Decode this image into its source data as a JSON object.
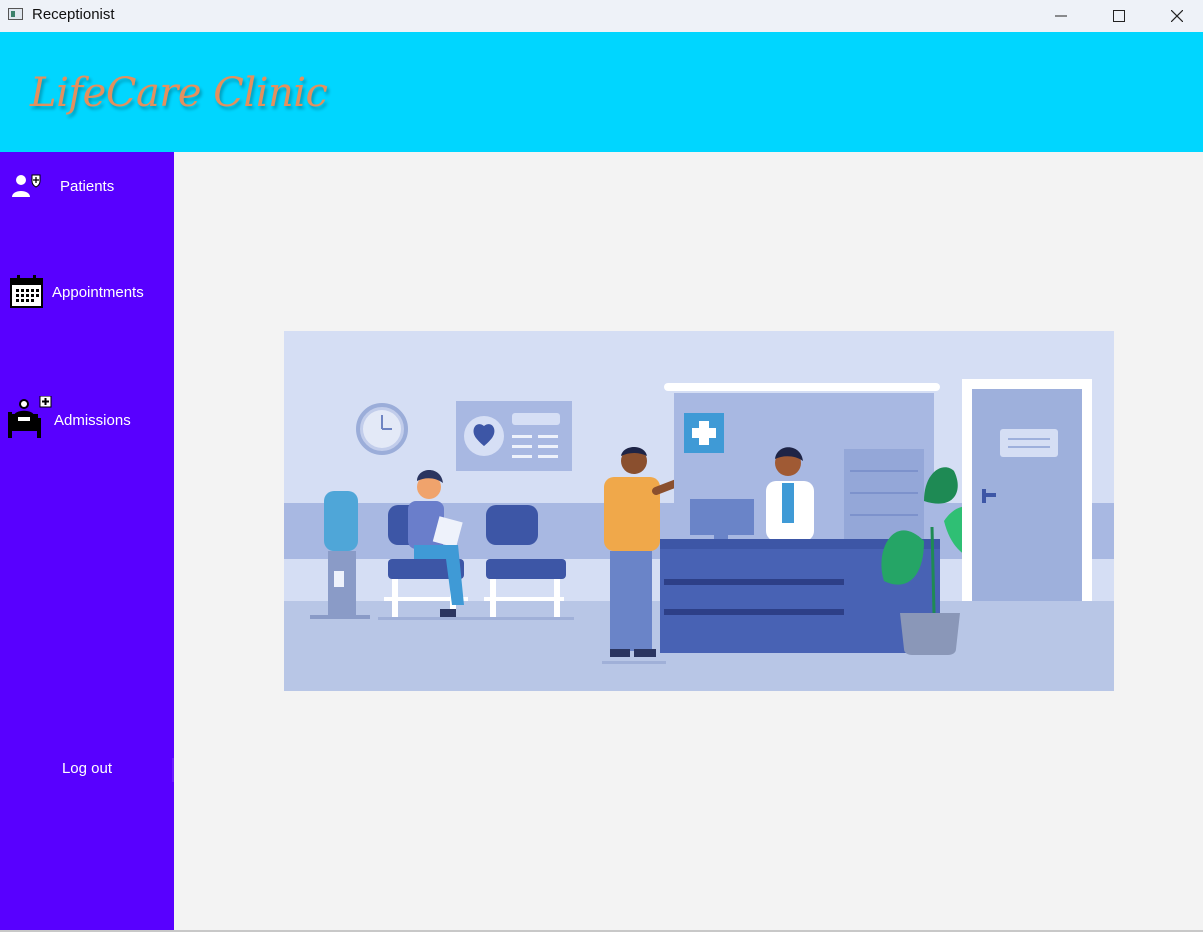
{
  "window": {
    "title": "Receptionist"
  },
  "header": {
    "brand": "LifeCare Clinic"
  },
  "sidebar": {
    "items": [
      {
        "label": "Patients",
        "icon": "patient-icon"
      },
      {
        "label": "Appointments",
        "icon": "calendar-icon"
      },
      {
        "label": "Admissions",
        "icon": "hospital-bed-icon"
      }
    ],
    "logout_label": "Log out"
  },
  "main": {
    "illustration": "reception-desk-illustration"
  },
  "colors": {
    "header": "#00d6ff",
    "sidebar": "#5800ff",
    "brand_text": "#e3905e",
    "background": "#f3f3f3"
  }
}
